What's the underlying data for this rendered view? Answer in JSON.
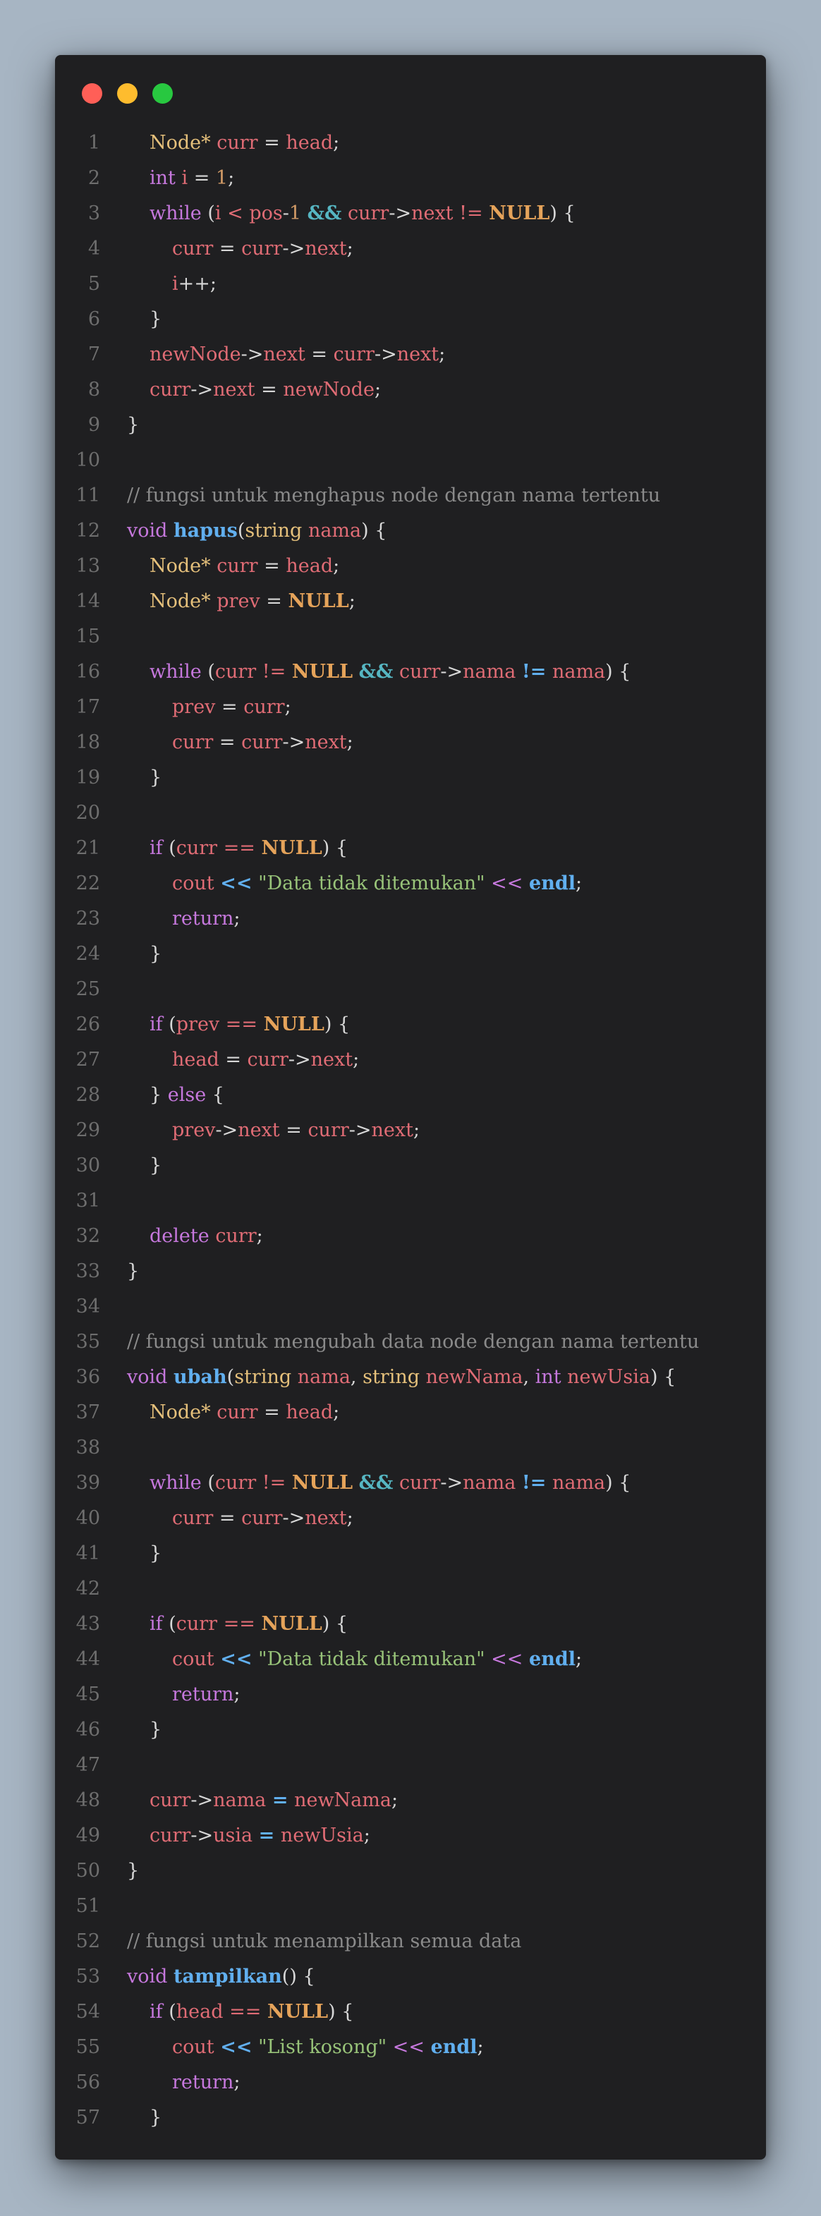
{
  "window": {
    "buttons": [
      "close",
      "minimize",
      "maximize"
    ]
  },
  "colors": {
    "plain": "#d7d7d7",
    "type": "#e5c07b",
    "variable": "#e06c75",
    "keyword": "#c678dd",
    "number": "#d19a66",
    "null": "#e5a35a",
    "operator": "#56b6c2",
    "function": "#61afef",
    "string": "#98c379",
    "comment": "#8a8a8a",
    "line_number": "#6e6e6e"
  },
  "code_lines": [
    {
      "n": "1",
      "indent": 1,
      "tokens": [
        [
          "type",
          "Node*"
        ],
        [
          "p",
          " "
        ],
        [
          "var",
          "curr"
        ],
        [
          "p",
          " = "
        ],
        [
          "var",
          "head"
        ],
        [
          "p",
          ";"
        ]
      ]
    },
    {
      "n": "2",
      "indent": 1,
      "tokens": [
        [
          "kw",
          "int"
        ],
        [
          "p",
          " "
        ],
        [
          "var",
          "i"
        ],
        [
          "p",
          " = "
        ],
        [
          "num",
          "1"
        ],
        [
          "p",
          ";"
        ]
      ]
    },
    {
      "n": "3",
      "indent": 1,
      "tokens": [
        [
          "kw",
          "while"
        ],
        [
          "p",
          " ("
        ],
        [
          "var",
          "i"
        ],
        [
          "p",
          " "
        ],
        [
          "var",
          "<"
        ],
        [
          "p",
          " "
        ],
        [
          "var",
          "pos"
        ],
        [
          "p",
          "-"
        ],
        [
          "num",
          "1"
        ],
        [
          "p",
          " "
        ],
        [
          "op",
          "&&"
        ],
        [
          "p",
          " "
        ],
        [
          "var",
          "curr"
        ],
        [
          "p",
          "->"
        ],
        [
          "var",
          "next"
        ],
        [
          "p",
          " "
        ],
        [
          "var",
          "!="
        ],
        [
          "p",
          " "
        ],
        [
          "null",
          "NULL"
        ],
        [
          "p",
          ") {"
        ]
      ]
    },
    {
      "n": "4",
      "indent": 2,
      "tokens": [
        [
          "var",
          "curr"
        ],
        [
          "p",
          " = "
        ],
        [
          "var",
          "curr"
        ],
        [
          "p",
          "->"
        ],
        [
          "var",
          "next"
        ],
        [
          "p",
          ";"
        ]
      ]
    },
    {
      "n": "5",
      "indent": 2,
      "tokens": [
        [
          "var",
          "i"
        ],
        [
          "p",
          "++;"
        ]
      ]
    },
    {
      "n": "6",
      "indent": 1,
      "tokens": [
        [
          "p",
          "}"
        ]
      ]
    },
    {
      "n": "7",
      "indent": 1,
      "tokens": [
        [
          "var",
          "newNode"
        ],
        [
          "p",
          "->"
        ],
        [
          "var",
          "next"
        ],
        [
          "p",
          " = "
        ],
        [
          "var",
          "curr"
        ],
        [
          "p",
          "->"
        ],
        [
          "var",
          "next"
        ],
        [
          "p",
          ";"
        ]
      ]
    },
    {
      "n": "8",
      "indent": 1,
      "tokens": [
        [
          "var",
          "curr"
        ],
        [
          "p",
          "->"
        ],
        [
          "var",
          "next"
        ],
        [
          "p",
          " = "
        ],
        [
          "var",
          "newNode"
        ],
        [
          "p",
          ";"
        ]
      ]
    },
    {
      "n": "9",
      "indent": 0,
      "tokens": [
        [
          "p",
          "}"
        ]
      ]
    },
    {
      "n": "10",
      "indent": 0,
      "tokens": []
    },
    {
      "n": "11",
      "indent": 0,
      "tokens": [
        [
          "cm",
          "// fungsi untuk menghapus node dengan nama tertentu"
        ]
      ]
    },
    {
      "n": "12",
      "indent": 0,
      "tokens": [
        [
          "kw",
          "void"
        ],
        [
          "p",
          " "
        ],
        [
          "fn",
          "hapus"
        ],
        [
          "p",
          "("
        ],
        [
          "type",
          "string"
        ],
        [
          "p",
          " "
        ],
        [
          "var",
          "nama"
        ],
        [
          "p",
          ") {"
        ]
      ]
    },
    {
      "n": "13",
      "indent": 1,
      "tokens": [
        [
          "type",
          "Node*"
        ],
        [
          "p",
          " "
        ],
        [
          "var",
          "curr"
        ],
        [
          "p",
          " = "
        ],
        [
          "var",
          "head"
        ],
        [
          "p",
          ";"
        ]
      ]
    },
    {
      "n": "14",
      "indent": 1,
      "tokens": [
        [
          "type",
          "Node*"
        ],
        [
          "p",
          " "
        ],
        [
          "var",
          "prev"
        ],
        [
          "p",
          " = "
        ],
        [
          "null",
          "NULL"
        ],
        [
          "p",
          ";"
        ]
      ]
    },
    {
      "n": "15",
      "indent": 0,
      "tokens": []
    },
    {
      "n": "16",
      "indent": 1,
      "tokens": [
        [
          "kw",
          "while"
        ],
        [
          "p",
          " ("
        ],
        [
          "var",
          "curr"
        ],
        [
          "p",
          " "
        ],
        [
          "var",
          "!="
        ],
        [
          "p",
          " "
        ],
        [
          "null",
          "NULL"
        ],
        [
          "p",
          " "
        ],
        [
          "op",
          "&&"
        ],
        [
          "p",
          " "
        ],
        [
          "var",
          "curr"
        ],
        [
          "p",
          "->"
        ],
        [
          "var",
          "nama"
        ],
        [
          "p",
          " "
        ],
        [
          "fn",
          "!="
        ],
        [
          "p",
          " "
        ],
        [
          "var",
          "nama"
        ],
        [
          "p",
          ") {"
        ]
      ]
    },
    {
      "n": "17",
      "indent": 2,
      "tokens": [
        [
          "var",
          "prev"
        ],
        [
          "p",
          " = "
        ],
        [
          "var",
          "curr"
        ],
        [
          "p",
          ";"
        ]
      ]
    },
    {
      "n": "18",
      "indent": 2,
      "tokens": [
        [
          "var",
          "curr"
        ],
        [
          "p",
          " = "
        ],
        [
          "var",
          "curr"
        ],
        [
          "p",
          "->"
        ],
        [
          "var",
          "next"
        ],
        [
          "p",
          ";"
        ]
      ]
    },
    {
      "n": "19",
      "indent": 1,
      "tokens": [
        [
          "p",
          "}"
        ]
      ]
    },
    {
      "n": "20",
      "indent": 0,
      "tokens": []
    },
    {
      "n": "21",
      "indent": 1,
      "tokens": [
        [
          "kw",
          "if"
        ],
        [
          "p",
          " ("
        ],
        [
          "var",
          "curr"
        ],
        [
          "p",
          " "
        ],
        [
          "var",
          "=="
        ],
        [
          "p",
          " "
        ],
        [
          "null",
          "NULL"
        ],
        [
          "p",
          ") {"
        ]
      ]
    },
    {
      "n": "22",
      "indent": 2,
      "tokens": [
        [
          "var",
          "cout"
        ],
        [
          "p",
          " "
        ],
        [
          "fn",
          "<<"
        ],
        [
          "p",
          " "
        ],
        [
          "str",
          "\"Data tidak ditemukan\""
        ],
        [
          "p",
          " "
        ],
        [
          "kw",
          "<<"
        ],
        [
          "p",
          " "
        ],
        [
          "fn",
          "endl"
        ],
        [
          "p",
          ";"
        ]
      ]
    },
    {
      "n": "23",
      "indent": 2,
      "tokens": [
        [
          "kw",
          "return"
        ],
        [
          "p",
          ";"
        ]
      ]
    },
    {
      "n": "24",
      "indent": 1,
      "tokens": [
        [
          "p",
          "}"
        ]
      ]
    },
    {
      "n": "25",
      "indent": 0,
      "tokens": []
    },
    {
      "n": "26",
      "indent": 1,
      "tokens": [
        [
          "kw",
          "if"
        ],
        [
          "p",
          " ("
        ],
        [
          "var",
          "prev"
        ],
        [
          "p",
          " "
        ],
        [
          "var",
          "=="
        ],
        [
          "p",
          " "
        ],
        [
          "null",
          "NULL"
        ],
        [
          "p",
          ") {"
        ]
      ]
    },
    {
      "n": "27",
      "indent": 2,
      "tokens": [
        [
          "var",
          "head"
        ],
        [
          "p",
          " = "
        ],
        [
          "var",
          "curr"
        ],
        [
          "p",
          "->"
        ],
        [
          "var",
          "next"
        ],
        [
          "p",
          ";"
        ]
      ]
    },
    {
      "n": "28",
      "indent": 1,
      "tokens": [
        [
          "p",
          "} "
        ],
        [
          "kw",
          "else"
        ],
        [
          "p",
          " {"
        ]
      ]
    },
    {
      "n": "29",
      "indent": 2,
      "tokens": [
        [
          "var",
          "prev"
        ],
        [
          "p",
          "->"
        ],
        [
          "var",
          "next"
        ],
        [
          "p",
          " = "
        ],
        [
          "var",
          "curr"
        ],
        [
          "p",
          "->"
        ],
        [
          "var",
          "next"
        ],
        [
          "p",
          ";"
        ]
      ]
    },
    {
      "n": "30",
      "indent": 1,
      "tokens": [
        [
          "p",
          "}"
        ]
      ]
    },
    {
      "n": "31",
      "indent": 0,
      "tokens": []
    },
    {
      "n": "32",
      "indent": 1,
      "tokens": [
        [
          "kw",
          "delete"
        ],
        [
          "p",
          " "
        ],
        [
          "var",
          "curr"
        ],
        [
          "p",
          ";"
        ]
      ]
    },
    {
      "n": "33",
      "indent": 0,
      "tokens": [
        [
          "p",
          "}"
        ]
      ]
    },
    {
      "n": "34",
      "indent": 0,
      "tokens": []
    },
    {
      "n": "35",
      "indent": 0,
      "tokens": [
        [
          "cm",
          "// fungsi untuk mengubah data node dengan nama tertentu"
        ]
      ]
    },
    {
      "n": "36",
      "indent": 0,
      "tokens": [
        [
          "kw",
          "void"
        ],
        [
          "p",
          " "
        ],
        [
          "fn",
          "ubah"
        ],
        [
          "p",
          "("
        ],
        [
          "type",
          "string"
        ],
        [
          "p",
          " "
        ],
        [
          "var",
          "nama"
        ],
        [
          "p",
          ", "
        ],
        [
          "type",
          "string"
        ],
        [
          "p",
          " "
        ],
        [
          "var",
          "newNama"
        ],
        [
          "p",
          ", "
        ],
        [
          "kw",
          "int"
        ],
        [
          "p",
          " "
        ],
        [
          "var",
          "newUsia"
        ],
        [
          "p",
          ") {"
        ]
      ]
    },
    {
      "n": "37",
      "indent": 1,
      "tokens": [
        [
          "type",
          "Node*"
        ],
        [
          "p",
          " "
        ],
        [
          "var",
          "curr"
        ],
        [
          "p",
          " = "
        ],
        [
          "var",
          "head"
        ],
        [
          "p",
          ";"
        ]
      ]
    },
    {
      "n": "38",
      "indent": 0,
      "tokens": []
    },
    {
      "n": "39",
      "indent": 1,
      "tokens": [
        [
          "kw",
          "while"
        ],
        [
          "p",
          " ("
        ],
        [
          "var",
          "curr"
        ],
        [
          "p",
          " "
        ],
        [
          "var",
          "!="
        ],
        [
          "p",
          " "
        ],
        [
          "null",
          "NULL"
        ],
        [
          "p",
          " "
        ],
        [
          "op",
          "&&"
        ],
        [
          "p",
          " "
        ],
        [
          "var",
          "curr"
        ],
        [
          "p",
          "->"
        ],
        [
          "var",
          "nama"
        ],
        [
          "p",
          " "
        ],
        [
          "fn",
          "!="
        ],
        [
          "p",
          " "
        ],
        [
          "var",
          "nama"
        ],
        [
          "p",
          ") {"
        ]
      ]
    },
    {
      "n": "40",
      "indent": 2,
      "tokens": [
        [
          "var",
          "curr"
        ],
        [
          "p",
          " = "
        ],
        [
          "var",
          "curr"
        ],
        [
          "p",
          "->"
        ],
        [
          "var",
          "next"
        ],
        [
          "p",
          ";"
        ]
      ]
    },
    {
      "n": "41",
      "indent": 1,
      "tokens": [
        [
          "p",
          "}"
        ]
      ]
    },
    {
      "n": "42",
      "indent": 0,
      "tokens": []
    },
    {
      "n": "43",
      "indent": 1,
      "tokens": [
        [
          "kw",
          "if"
        ],
        [
          "p",
          " ("
        ],
        [
          "var",
          "curr"
        ],
        [
          "p",
          " "
        ],
        [
          "var",
          "=="
        ],
        [
          "p",
          " "
        ],
        [
          "null",
          "NULL"
        ],
        [
          "p",
          ") {"
        ]
      ]
    },
    {
      "n": "44",
      "indent": 2,
      "tokens": [
        [
          "var",
          "cout"
        ],
        [
          "p",
          " "
        ],
        [
          "fn",
          "<<"
        ],
        [
          "p",
          " "
        ],
        [
          "str",
          "\"Data tidak ditemukan\""
        ],
        [
          "p",
          " "
        ],
        [
          "kw",
          "<<"
        ],
        [
          "p",
          " "
        ],
        [
          "fn",
          "endl"
        ],
        [
          "p",
          ";"
        ]
      ]
    },
    {
      "n": "45",
      "indent": 2,
      "tokens": [
        [
          "kw",
          "return"
        ],
        [
          "p",
          ";"
        ]
      ]
    },
    {
      "n": "46",
      "indent": 1,
      "tokens": [
        [
          "p",
          "}"
        ]
      ]
    },
    {
      "n": "47",
      "indent": 0,
      "tokens": []
    },
    {
      "n": "48",
      "indent": 1,
      "tokens": [
        [
          "var",
          "curr"
        ],
        [
          "p",
          "->"
        ],
        [
          "var",
          "nama"
        ],
        [
          "p",
          " "
        ],
        [
          "fn",
          "="
        ],
        [
          "p",
          " "
        ],
        [
          "var",
          "newNama"
        ],
        [
          "p",
          ";"
        ]
      ]
    },
    {
      "n": "49",
      "indent": 1,
      "tokens": [
        [
          "var",
          "curr"
        ],
        [
          "p",
          "->"
        ],
        [
          "var",
          "usia"
        ],
        [
          "p",
          " "
        ],
        [
          "fn",
          "="
        ],
        [
          "p",
          " "
        ],
        [
          "var",
          "newUsia"
        ],
        [
          "p",
          ";"
        ]
      ]
    },
    {
      "n": "50",
      "indent": 0,
      "tokens": [
        [
          "p",
          "}"
        ]
      ]
    },
    {
      "n": "51",
      "indent": 0,
      "tokens": []
    },
    {
      "n": "52",
      "indent": 0,
      "tokens": [
        [
          "cm",
          "// fungsi untuk menampilkan semua data"
        ]
      ]
    },
    {
      "n": "53",
      "indent": 0,
      "tokens": [
        [
          "kw",
          "void"
        ],
        [
          "p",
          " "
        ],
        [
          "fn",
          "tampilkan"
        ],
        [
          "p",
          "() {"
        ]
      ]
    },
    {
      "n": "54",
      "indent": 1,
      "tokens": [
        [
          "kw",
          "if"
        ],
        [
          "p",
          " ("
        ],
        [
          "var",
          "head"
        ],
        [
          "p",
          " "
        ],
        [
          "var",
          "=="
        ],
        [
          "p",
          " "
        ],
        [
          "null",
          "NULL"
        ],
        [
          "p",
          ") {"
        ]
      ]
    },
    {
      "n": "55",
      "indent": 2,
      "tokens": [
        [
          "var",
          "cout"
        ],
        [
          "p",
          " "
        ],
        [
          "fn",
          "<<"
        ],
        [
          "p",
          " "
        ],
        [
          "str",
          "\"List kosong\""
        ],
        [
          "p",
          " "
        ],
        [
          "kw",
          "<<"
        ],
        [
          "p",
          " "
        ],
        [
          "fn",
          "endl"
        ],
        [
          "p",
          ";"
        ]
      ]
    },
    {
      "n": "56",
      "indent": 2,
      "tokens": [
        [
          "kw",
          "return"
        ],
        [
          "p",
          ";"
        ]
      ]
    },
    {
      "n": "57",
      "indent": 1,
      "tokens": [
        [
          "p",
          "}"
        ]
      ]
    }
  ]
}
